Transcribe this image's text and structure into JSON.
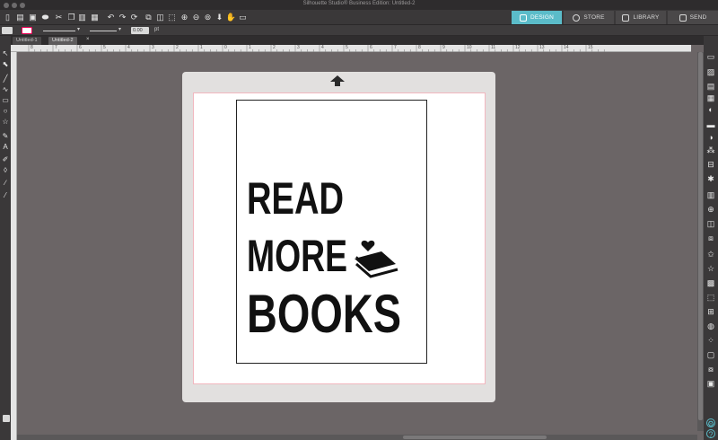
{
  "window": {
    "title": "Silhouette Studio® Business Edition: Untitled-2"
  },
  "nav_tabs": [
    {
      "label": "DESIGN",
      "active": true
    },
    {
      "label": "STORE",
      "active": false
    },
    {
      "label": "LIBRARY",
      "active": false
    },
    {
      "label": "SEND",
      "active": false
    }
  ],
  "options": {
    "line_width_value": "0.00",
    "unit": "pt"
  },
  "doc_tabs": [
    {
      "label": "Untitled-1",
      "active": false
    },
    {
      "label": "Untitled-2",
      "active": true
    }
  ],
  "ruler_top_labels": [
    "8",
    "7",
    "6",
    "5",
    "4",
    "3",
    "2",
    "1",
    "0",
    "1",
    "2",
    "3",
    "4",
    "5",
    "6",
    "7",
    "8",
    "9",
    "10",
    "11",
    "12",
    "13",
    "14",
    "15"
  ],
  "artwork": {
    "line1": "READ",
    "line2": "MORE",
    "line3": "BOOKS"
  },
  "colors": {
    "accent": "#5bbcc9",
    "cut_border": "#f2b7bf",
    "workspace": "#6b6566"
  },
  "icons": {
    "toolbar": [
      "new-icon",
      "open-icon",
      "save-icon",
      "print-icon",
      "cut-icon",
      "copy-icon",
      "paste-icon",
      "delete-icon",
      "undo-icon",
      "redo-icon",
      "refresh-icon",
      "group-icon",
      "ungroup-icon",
      "replicate-icon",
      "zoom-in-icon",
      "zoom-out-icon",
      "zoom-fit-icon",
      "move-icon",
      "pan-icon",
      "fullscreen-icon"
    ],
    "left": [
      "pointer-icon",
      "node-edit-icon",
      "line-icon",
      "curve-icon",
      "rectangle-icon",
      "ellipse-icon",
      "star-icon",
      "pen-icon",
      "text-icon",
      "paint-icon",
      "eraser-icon",
      "knife-icon",
      "eyedropper-icon"
    ],
    "right": [
      "page-setup-icon",
      "send-icon",
      "library-icon",
      "grid-icon",
      "fill-icon",
      "line-style-icon",
      "gradient-icon",
      "pattern-icon",
      "transform-icon",
      "align-icon",
      "replicate-panel-icon",
      "offset-icon",
      "trace-icon",
      "modify-icon",
      "text-style-icon",
      "layers-icon",
      "design-store-icon",
      "sketch-icon",
      "nesting-icon",
      "shadow-icon",
      "rhinestone-icon",
      "emboss-icon",
      "print-cut-icon",
      "color-icon"
    ]
  }
}
